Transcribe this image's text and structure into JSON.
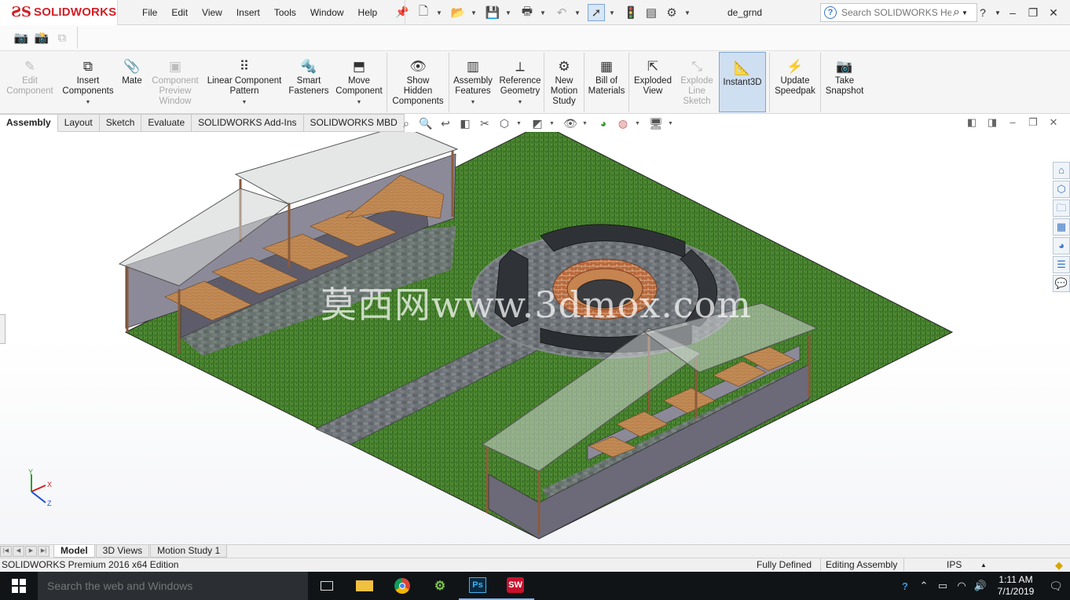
{
  "titlebar": {
    "brand": "SOLIDWORKS",
    "menus": [
      "File",
      "Edit",
      "View",
      "Insert",
      "Tools",
      "Window",
      "Help"
    ],
    "document_title": "de_grnd",
    "help_search_placeholder": "Search SOLIDWORKS Help"
  },
  "command_manager": {
    "buttons": [
      {
        "label": "Edit\nComponent",
        "icon": "edit-component-icon",
        "enabled": false
      },
      {
        "label": "Insert\nComponents",
        "icon": "insert-components-icon",
        "enabled": true,
        "dropdown": true
      },
      {
        "label": "Mate",
        "icon": "mate-icon",
        "enabled": true
      },
      {
        "label": "Component\nPreview\nWindow",
        "icon": "component-preview-icon",
        "enabled": false
      },
      {
        "label": "Linear Component\nPattern",
        "icon": "linear-pattern-icon",
        "enabled": true,
        "dropdown": true
      },
      {
        "label": "Smart\nFasteners",
        "icon": "smart-fasteners-icon",
        "enabled": true
      },
      {
        "label": "Move\nComponent",
        "icon": "move-component-icon",
        "enabled": true,
        "dropdown": true
      },
      {
        "label": "Show\nHidden\nComponents",
        "icon": "show-hidden-icon",
        "enabled": true
      },
      {
        "label": "Assembly\nFeatures",
        "icon": "assembly-features-icon",
        "enabled": true,
        "dropdown": true
      },
      {
        "label": "Reference\nGeometry",
        "icon": "reference-geometry-icon",
        "enabled": true,
        "dropdown": true
      },
      {
        "label": "New\nMotion\nStudy",
        "icon": "motion-study-icon",
        "enabled": true
      },
      {
        "label": "Bill of\nMaterials",
        "icon": "bill-of-materials-icon",
        "enabled": true
      },
      {
        "label": "Exploded\nView",
        "icon": "exploded-view-icon",
        "enabled": true
      },
      {
        "label": "Explode\nLine\nSketch",
        "icon": "explode-line-sketch-icon",
        "enabled": false
      },
      {
        "label": "Instant3D",
        "icon": "instant3d-icon",
        "enabled": true,
        "active": true
      },
      {
        "label": "Update\nSpeedpak",
        "icon": "speedpak-icon",
        "enabled": true
      },
      {
        "label": "Take\nSnapshot",
        "icon": "snapshot-icon",
        "enabled": true
      }
    ]
  },
  "tabs": [
    "Assembly",
    "Layout",
    "Sketch",
    "Evaluate",
    "SOLIDWORKS Add-Ins",
    "SOLIDWORKS MBD"
  ],
  "active_tab": "Assembly",
  "viewport": {
    "watermark": "莫西网www.3dmox.com",
    "triad_labels": {
      "x": "X",
      "y": "Y",
      "z": "Z"
    }
  },
  "bottom_tabs": [
    "Model",
    "3D Views",
    "Motion Study 1"
  ],
  "active_bottom_tab": "Model",
  "status": {
    "edition": "SOLIDWORKS Premium 2016 x64 Edition",
    "definition": "Fully Defined",
    "mode": "Editing Assembly",
    "units": "IPS"
  },
  "taskbar": {
    "search_placeholder": "Search the web and Windows",
    "apps": [
      "task-view",
      "file-explorer",
      "chrome",
      "android-studio",
      "photoshop",
      "solidworks-2016"
    ],
    "photoshop_label": "Ps",
    "solidworks_label": "SW",
    "time": "1:11 AM",
    "date": "7/1/2019"
  },
  "colors": {
    "brand_red": "#d21f26",
    "grass": "#3f7a2a",
    "path_stone": "#6f7378",
    "brick": "#b7653a",
    "taskbar": "#101417",
    "accent_blue": "#3a76c4"
  }
}
